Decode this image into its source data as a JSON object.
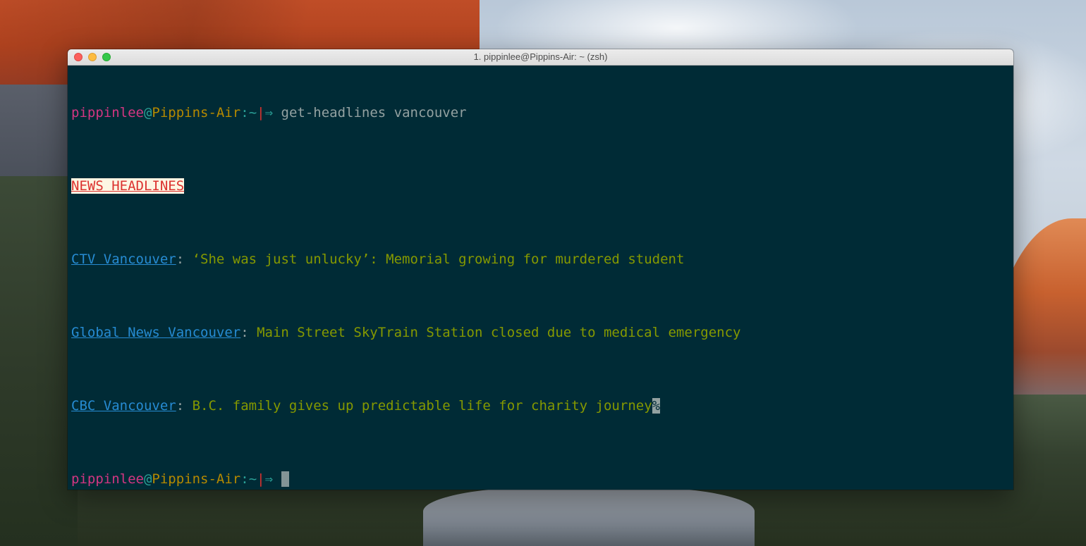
{
  "window": {
    "title": "1. pippinlee@Pippins-Air: ~ (zsh)"
  },
  "prompt": {
    "user": "pippinlee",
    "at": "@",
    "host": "Pippins-Air",
    "colon": ":",
    "path": "~",
    "separator": "|",
    "arrow": "⇒"
  },
  "command": "get-headlines vancouver",
  "banner": "NEWS HEADLINES",
  "headlines": [
    {
      "source": "CTV Vancouver",
      "separator": ": ",
      "text": "‘She was just unlucky’: Memorial growing for murdered student"
    },
    {
      "source": "Global News Vancouver",
      "separator": ": ",
      "text": "Main Street SkyTrain Station closed due to medical emergency"
    },
    {
      "source": "CBC Vancouver",
      "separator": ": ",
      "text": "B.C. family gives up predictable life for charity journey"
    }
  ],
  "end_of_line_marker": "%",
  "colors": {
    "terminal_background": "#002b36",
    "user": "#d33682",
    "host": "#b58900",
    "accent": "#2aa198",
    "link": "#268bd2",
    "headline_text": "#859900",
    "banner": "#dc322f"
  }
}
